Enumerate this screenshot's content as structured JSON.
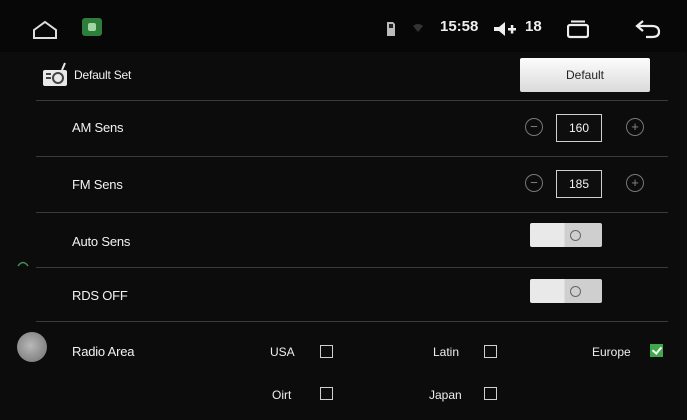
{
  "statusbar": {
    "time": "15:58",
    "volume": "18",
    "icons": [
      "home-icon",
      "app-icon",
      "sd-card-icon",
      "wifi-icon",
      "volume-icon",
      "recents-icon",
      "back-icon"
    ]
  },
  "settings": {
    "default_set": {
      "label": "Default Set",
      "button": "Default",
      "icon": "radio-settings-icon"
    },
    "am_sens": {
      "label": "AM Sens",
      "value": "160"
    },
    "fm_sens": {
      "label": "FM Sens",
      "value": "185"
    },
    "auto_sens": {
      "label": "Auto Sens",
      "enabled": false
    },
    "rds_off": {
      "label": "RDS OFF",
      "enabled": false
    },
    "radio_area": {
      "label": "Radio Area",
      "options": [
        {
          "label": "USA",
          "checked": false
        },
        {
          "label": "Latin",
          "checked": false
        },
        {
          "label": "Europe",
          "checked": true
        },
        {
          "label": "Oirt",
          "checked": false
        },
        {
          "label": "Japan",
          "checked": false
        }
      ]
    }
  },
  "colors": {
    "background": "#0c0c0c",
    "checkbox_checked": "#3fa84a",
    "divider": "#3b3b3b"
  }
}
